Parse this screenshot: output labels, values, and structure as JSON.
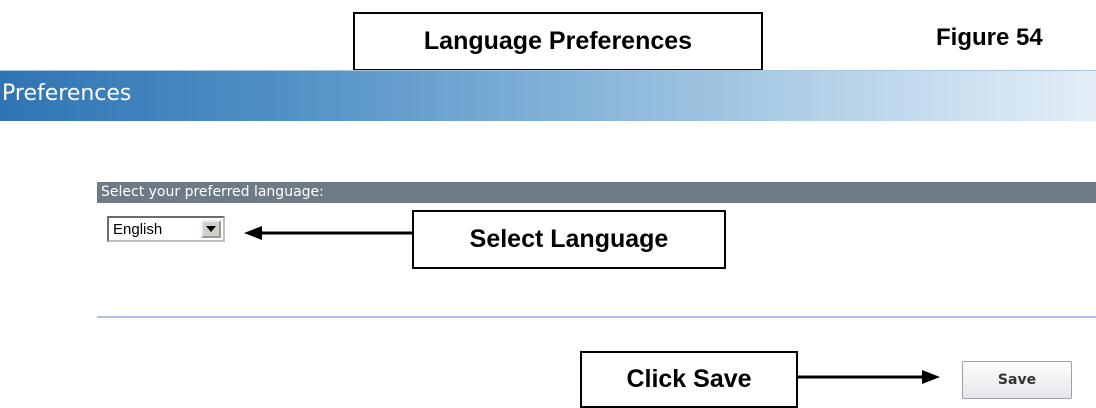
{
  "annotations": {
    "title_callout": "Language Preferences",
    "figure_label": "Figure 54",
    "select_callout": "Select Language",
    "save_callout": "Click Save"
  },
  "header": {
    "title": "Preferences"
  },
  "language_section": {
    "label": "Select your preferred language:",
    "selected_language": "English"
  },
  "actions": {
    "save_label": "Save"
  },
  "colors": {
    "header_gradient_start": "#2f74b4",
    "header_gradient_end": "#e3eef7",
    "section_bar": "#6e7b86",
    "divider": "#b7bde3"
  },
  "icons": {
    "dropdown": "chevron-down-icon",
    "arrow_left": "arrow-left-icon",
    "arrow_right": "arrow-right-icon"
  }
}
